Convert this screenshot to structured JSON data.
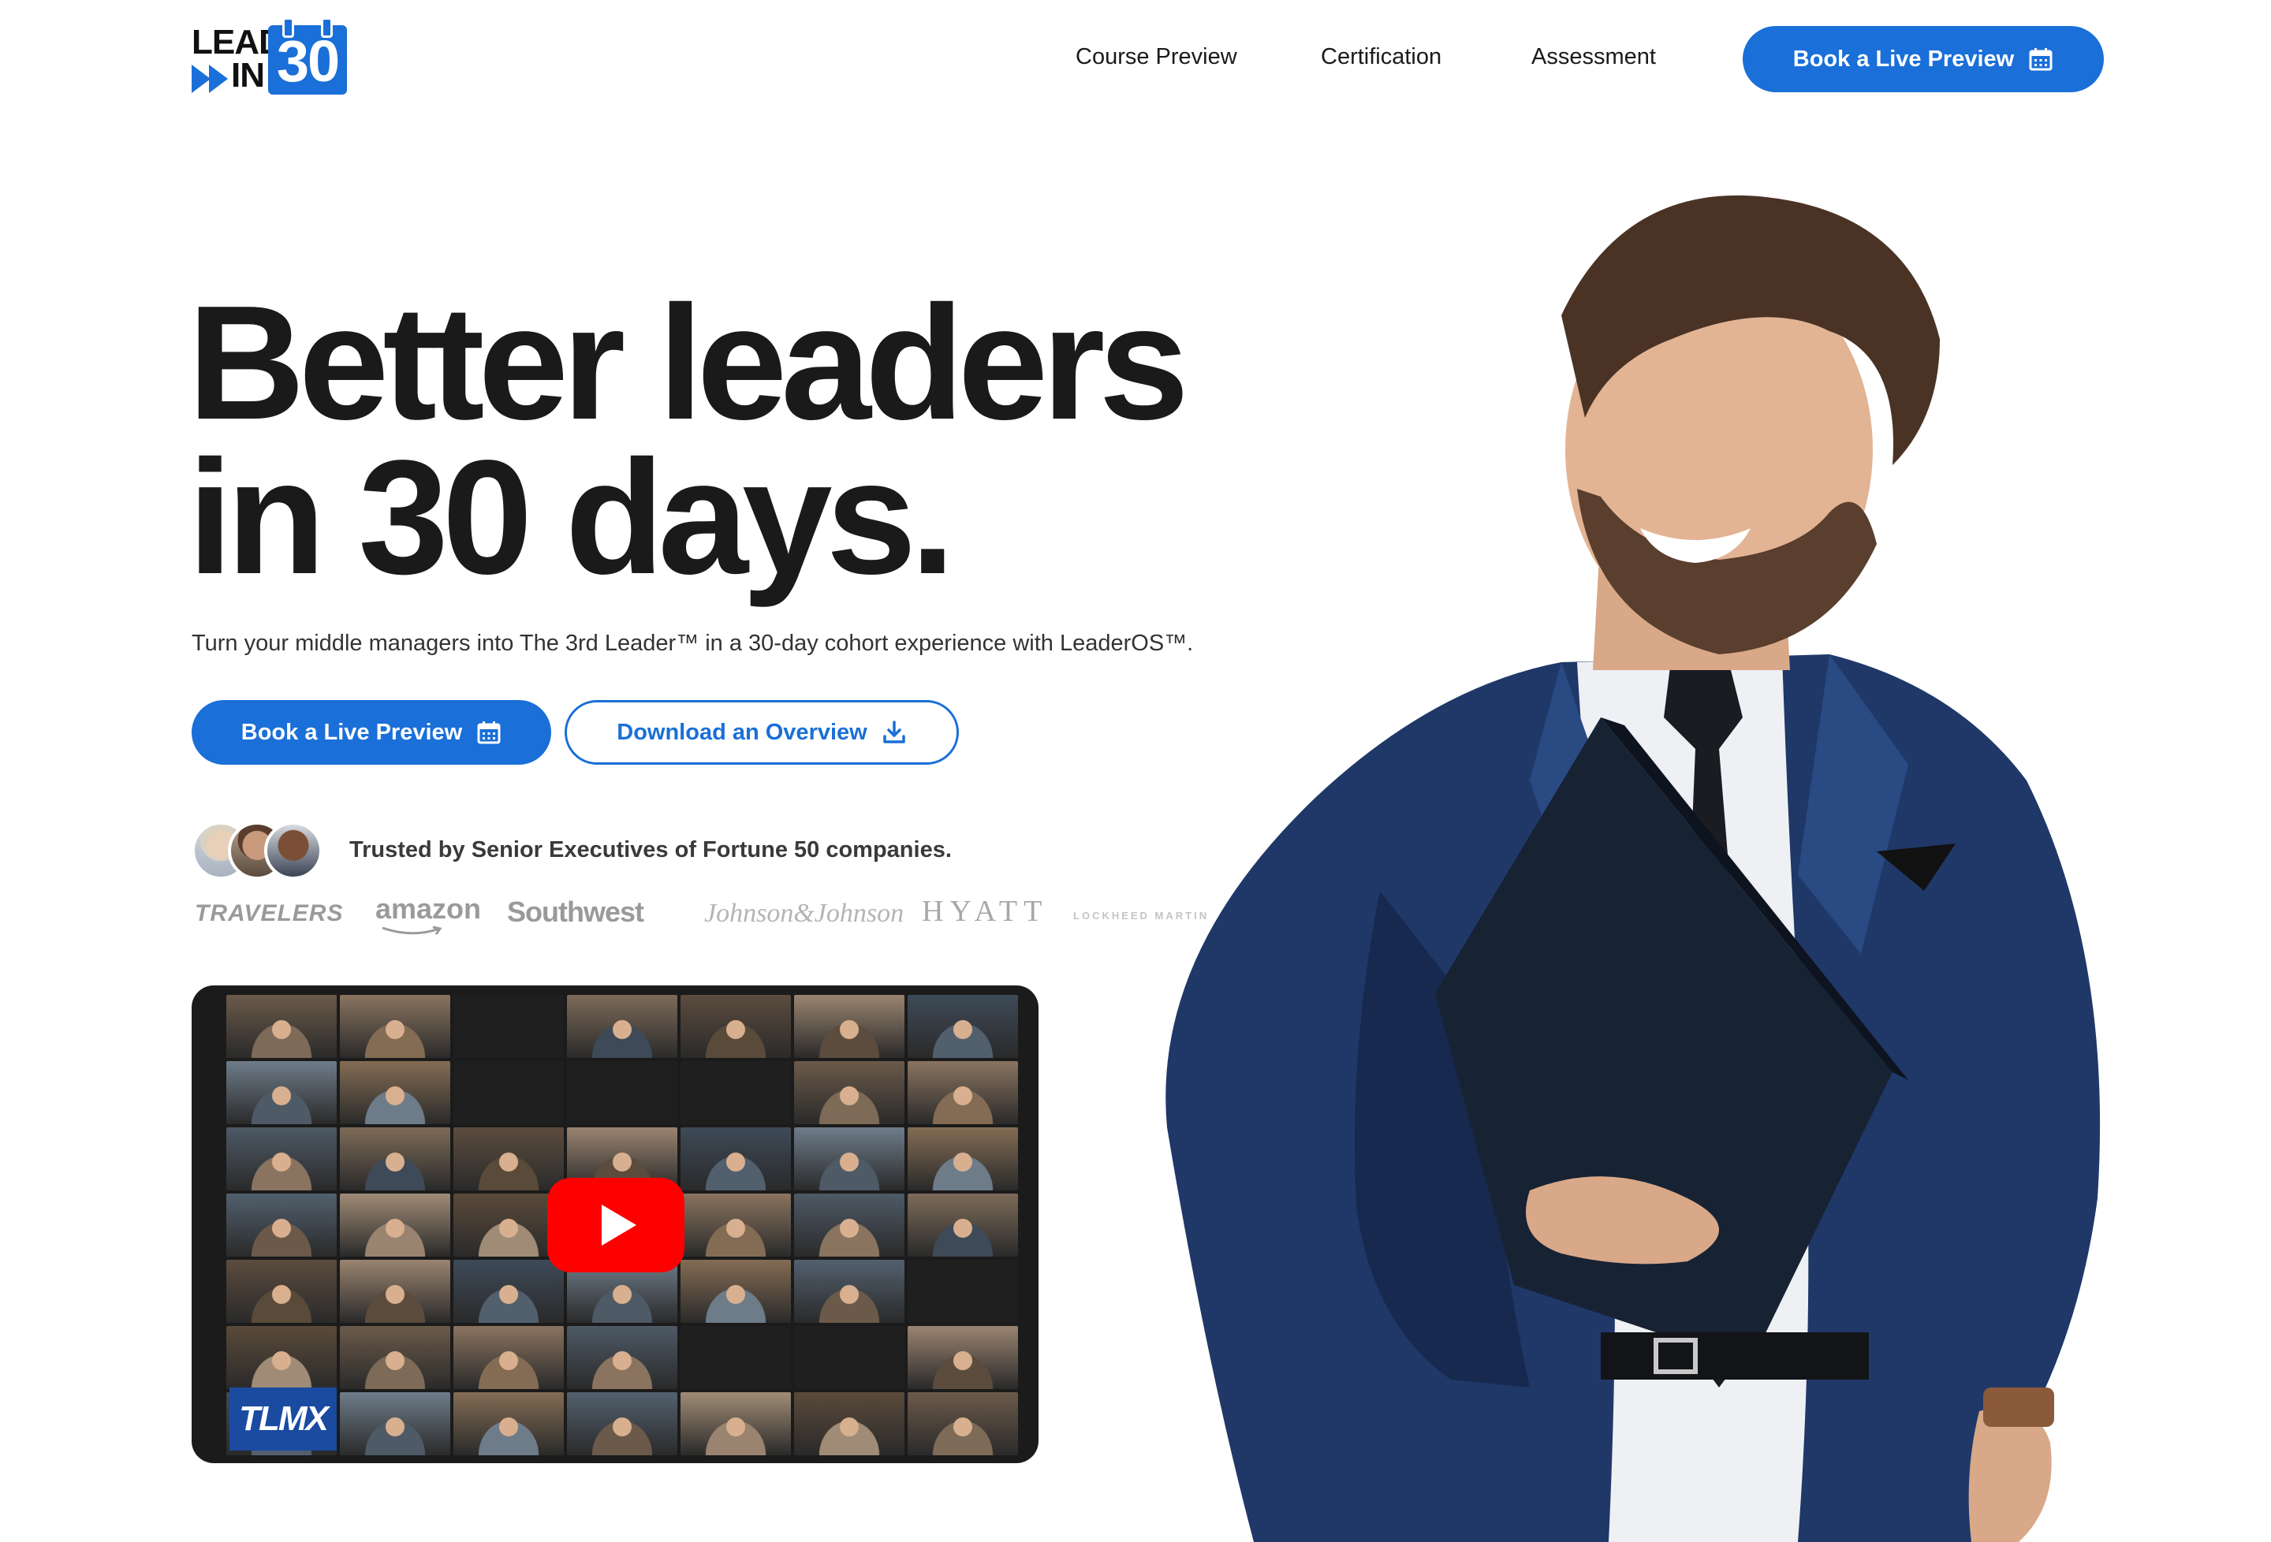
{
  "nav": {
    "logo_top": "LEAD",
    "logo_bottom": "IN",
    "logo_number": "30",
    "links": [
      "Course Preview",
      "Certification",
      "Assessment"
    ],
    "cta_label": "Book a Live Preview"
  },
  "hero": {
    "headline_line1": "Better leaders",
    "headline_line2": "in 30 days.",
    "subheadline": "Turn your middle managers into The 3rd Leader™ in a 30-day cohort experience with LeaderOS™.",
    "primary_cta": "Book a Live Preview",
    "secondary_cta": "Download an Overview"
  },
  "trust": {
    "text": "Trusted by Senior Executives of Fortune 50 companies.",
    "brands": [
      "TRAVELERS",
      "amazon",
      "Southwest",
      "Johnson&Johnson",
      "HYATT",
      "LOCKHEED MARTIN"
    ]
  },
  "video": {
    "overlay_brand": "TLMX",
    "play_icon": "play-icon"
  },
  "colors": {
    "accent": "#1a6fd8",
    "text": "#1a1a1a",
    "video_bg": "#1b1b1b",
    "youtube_red": "#ff0000"
  }
}
